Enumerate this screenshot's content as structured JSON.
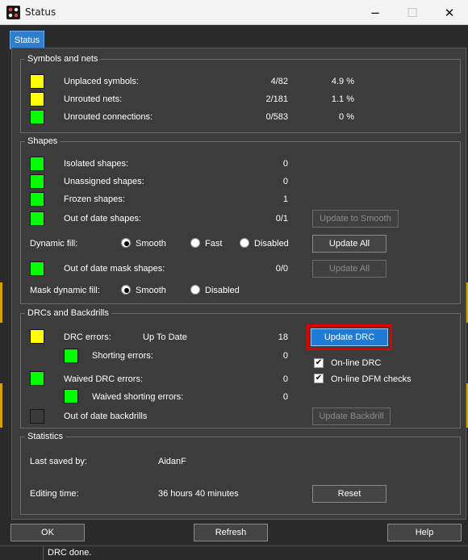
{
  "window": {
    "title": "Status"
  },
  "tabs": [
    {
      "label": "Status"
    }
  ],
  "symbols_and_nets": {
    "title": "Symbols and nets",
    "rows": [
      {
        "label": "Unplaced symbols:",
        "value": "4/82",
        "percent": "4.9 %",
        "color": "#ffff00"
      },
      {
        "label": "Unrouted nets:",
        "value": "2/181",
        "percent": "1.1 %",
        "color": "#ffff00"
      },
      {
        "label": "Unrouted connections:",
        "value": "0/583",
        "percent": "0 %",
        "color": "#00ff00"
      }
    ]
  },
  "shapes": {
    "title": "Shapes",
    "rows": [
      {
        "label": "Isolated shapes:",
        "value": "0",
        "color": "#00ff00"
      },
      {
        "label": "Unassigned shapes:",
        "value": "0",
        "color": "#00ff00"
      },
      {
        "label": "Frozen shapes:",
        "value": "1",
        "color": "#00ff00"
      },
      {
        "label": "Out of date shapes:",
        "value": "0/1",
        "color": "#00ff00"
      }
    ],
    "update_to_smooth": "Update to Smooth",
    "dynamic_fill": {
      "label": "Dynamic fill:",
      "options": [
        "Smooth",
        "Fast",
        "Disabled"
      ],
      "selected": "Smooth"
    },
    "update_all_1": "Update All",
    "mask_row": {
      "label": "Out of date mask shapes:",
      "value": "0/0",
      "color": "#00ff00"
    },
    "update_all_2": "Update All",
    "mask_dynamic_fill": {
      "label": "Mask dynamic fill:",
      "options": [
        "Smooth",
        "Disabled"
      ],
      "selected": "Smooth"
    }
  },
  "drcs": {
    "title": "DRCs and Backdrills",
    "drc_errors": {
      "label": "DRC errors:",
      "state": "Up To Date",
      "value": "18",
      "color": "#ffff00"
    },
    "shorting_errors": {
      "label": "Shorting errors:",
      "value": "0",
      "color": "#00ff00"
    },
    "waived_drc_errors": {
      "label": "Waived DRC errors:",
      "value": "0",
      "color": "#00ff00"
    },
    "waived_shorting_errors": {
      "label": "Waived shorting errors:",
      "value": "0",
      "color": "#00ff00"
    },
    "out_of_date_backdrills": {
      "label": "Out of date backdrills",
      "color": "#3a3a3a"
    },
    "update_drc": "Update DRC",
    "online_drc": {
      "label": "On-line DRC",
      "checked": true
    },
    "online_dfm": {
      "label": "On-line DFM checks",
      "checked": true
    },
    "update_backdrill": "Update Backdrill"
  },
  "statistics": {
    "title": "Statistics",
    "last_saved_by": {
      "label": "Last saved by:",
      "value": "AidanF"
    },
    "editing_time": {
      "label": "Editing time:",
      "value": "36 hours 40 minutes"
    },
    "reset": "Reset"
  },
  "buttons": {
    "ok": "OK",
    "refresh": "Refresh",
    "help": "Help"
  },
  "status_bar": {
    "message": "DRC done."
  },
  "icons": {
    "minimize": "−",
    "maximize": "☐",
    "close": "✕",
    "check": "✔"
  },
  "colors": {
    "accent": "#1f7bd6",
    "highlight": "#e00000",
    "warning": "#ffff00",
    "ok": "#00ff00"
  }
}
